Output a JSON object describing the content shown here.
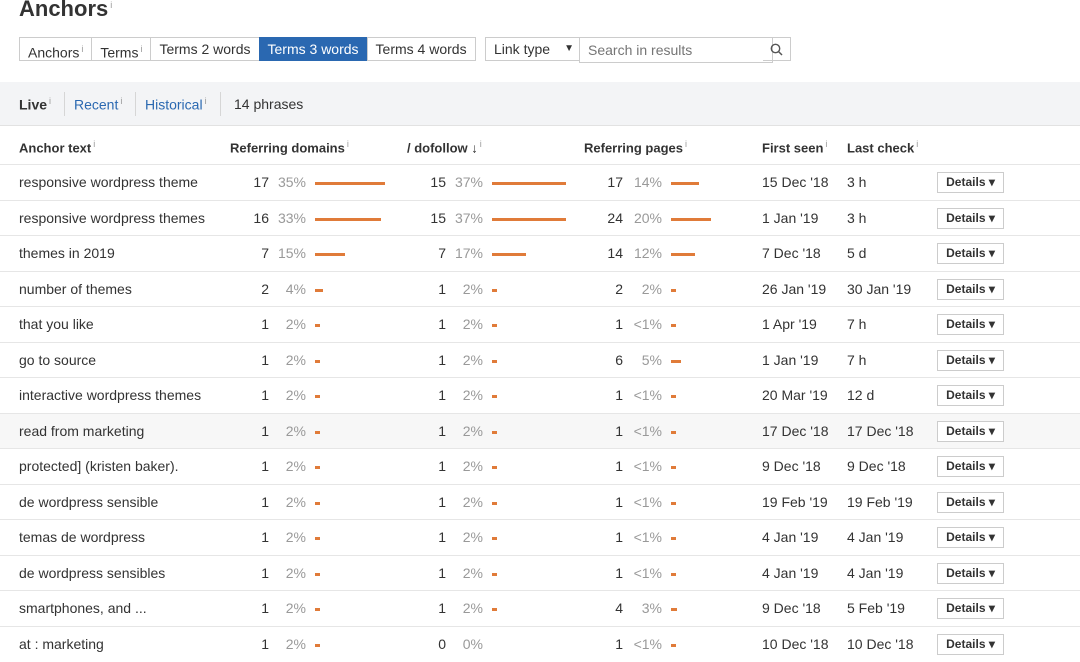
{
  "page": {
    "title": "Anchors",
    "info": "i"
  },
  "tabs": [
    {
      "label": "Anchors",
      "info": "i"
    },
    {
      "label": "Terms",
      "info": "i"
    },
    {
      "label": "Terms 2 words"
    },
    {
      "label": "Terms 3 words",
      "active": true
    },
    {
      "label": "Terms 4 words"
    }
  ],
  "filters": {
    "link_type": "Link type",
    "search_placeholder": "Search in results"
  },
  "subbar": {
    "live": "Live",
    "recent": "Recent",
    "historical": "Historical",
    "count": "14 phrases",
    "info": "i"
  },
  "headers": {
    "anchor": "Anchor text",
    "refdomains": "Referring domains",
    "dofollow": "/ dofollow",
    "refpages": "Referring pages",
    "first_seen": "First seen",
    "last_check": "Last check",
    "info": "i"
  },
  "details_label": "Details ▾",
  "rows": [
    {
      "anchor": "responsive wordpress theme",
      "rd": "17",
      "rd_pct": "35%",
      "df": "15",
      "df_pct": "37%",
      "rp": "17",
      "rp_pct": "14%",
      "first": "15 Dec '18",
      "last": "3 h",
      "rd_bar": 35,
      "df_bar": 37,
      "rp_bar": 14
    },
    {
      "anchor": "responsive wordpress themes",
      "rd": "16",
      "rd_pct": "33%",
      "df": "15",
      "df_pct": "37%",
      "rp": "24",
      "rp_pct": "20%",
      "first": "1 Jan '19",
      "last": "3 h",
      "rd_bar": 33,
      "df_bar": 37,
      "rp_bar": 20
    },
    {
      "anchor": "themes in 2019",
      "rd": "7",
      "rd_pct": "15%",
      "df": "7",
      "df_pct": "17%",
      "rp": "14",
      "rp_pct": "12%",
      "first": "7 Dec '18",
      "last": "5 d",
      "rd_bar": 15,
      "df_bar": 17,
      "rp_bar": 12
    },
    {
      "anchor": "number of themes",
      "rd": "2",
      "rd_pct": "4%",
      "df": "1",
      "df_pct": "2%",
      "rp": "2",
      "rp_pct": "2%",
      "first": "26 Jan '19",
      "last": "30 Jan '19",
      "rd_bar": 4,
      "df_bar": 2,
      "rp_bar": 2
    },
    {
      "anchor": "that you like",
      "rd": "1",
      "rd_pct": "2%",
      "df": "1",
      "df_pct": "2%",
      "rp": "1",
      "rp_pct": "<1%",
      "first": "1 Apr '19",
      "last": "7 h",
      "rd_bar": 2,
      "df_bar": 2,
      "rp_bar": 1
    },
    {
      "anchor": "go to source",
      "rd": "1",
      "rd_pct": "2%",
      "df": "1",
      "df_pct": "2%",
      "rp": "6",
      "rp_pct": "5%",
      "first": "1 Jan '19",
      "last": "7 h",
      "rd_bar": 2,
      "df_bar": 2,
      "rp_bar": 5
    },
    {
      "anchor": "interactive wordpress themes",
      "rd": "1",
      "rd_pct": "2%",
      "df": "1",
      "df_pct": "2%",
      "rp": "1",
      "rp_pct": "<1%",
      "first": "20 Mar '19",
      "last": "12 d",
      "rd_bar": 2,
      "df_bar": 2,
      "rp_bar": 1
    },
    {
      "anchor": "read from marketing",
      "rd": "1",
      "rd_pct": "2%",
      "df": "1",
      "df_pct": "2%",
      "rp": "1",
      "rp_pct": "<1%",
      "first": "17 Dec '18",
      "last": "17 Dec '18",
      "rd_bar": 2,
      "df_bar": 2,
      "rp_bar": 1,
      "shaded": true
    },
    {
      "anchor": "protected] (kristen baker).",
      "rd": "1",
      "rd_pct": "2%",
      "df": "1",
      "df_pct": "2%",
      "rp": "1",
      "rp_pct": "<1%",
      "first": "9 Dec '18",
      "last": "9 Dec '18",
      "rd_bar": 2,
      "df_bar": 2,
      "rp_bar": 1
    },
    {
      "anchor": "de wordpress sensible",
      "rd": "1",
      "rd_pct": "2%",
      "df": "1",
      "df_pct": "2%",
      "rp": "1",
      "rp_pct": "<1%",
      "first": "19 Feb '19",
      "last": "19 Feb '19",
      "rd_bar": 2,
      "df_bar": 2,
      "rp_bar": 1
    },
    {
      "anchor": "temas de wordpress",
      "rd": "1",
      "rd_pct": "2%",
      "df": "1",
      "df_pct": "2%",
      "rp": "1",
      "rp_pct": "<1%",
      "first": "4 Jan '19",
      "last": "4 Jan '19",
      "rd_bar": 2,
      "df_bar": 2,
      "rp_bar": 1
    },
    {
      "anchor": "de wordpress sensibles",
      "rd": "1",
      "rd_pct": "2%",
      "df": "1",
      "df_pct": "2%",
      "rp": "1",
      "rp_pct": "<1%",
      "first": "4 Jan '19",
      "last": "4 Jan '19",
      "rd_bar": 2,
      "df_bar": 2,
      "rp_bar": 1
    },
    {
      "anchor": "smartphones, and ...",
      "rd": "1",
      "rd_pct": "2%",
      "df": "1",
      "df_pct": "2%",
      "rp": "4",
      "rp_pct": "3%",
      "first": "9 Dec '18",
      "last": "5 Feb '19",
      "rd_bar": 2,
      "df_bar": 2,
      "rp_bar": 3
    },
    {
      "anchor": "at : marketing",
      "rd": "1",
      "rd_pct": "2%",
      "df": "0",
      "df_pct": "0%",
      "rp": "1",
      "rp_pct": "<1%",
      "first": "10 Dec '18",
      "last": "10 Dec '18",
      "rd_bar": 2,
      "df_bar": 0,
      "rp_bar": 1
    }
  ],
  "colors": {
    "accent": "#2a68b1",
    "bar": "#e07b39"
  }
}
